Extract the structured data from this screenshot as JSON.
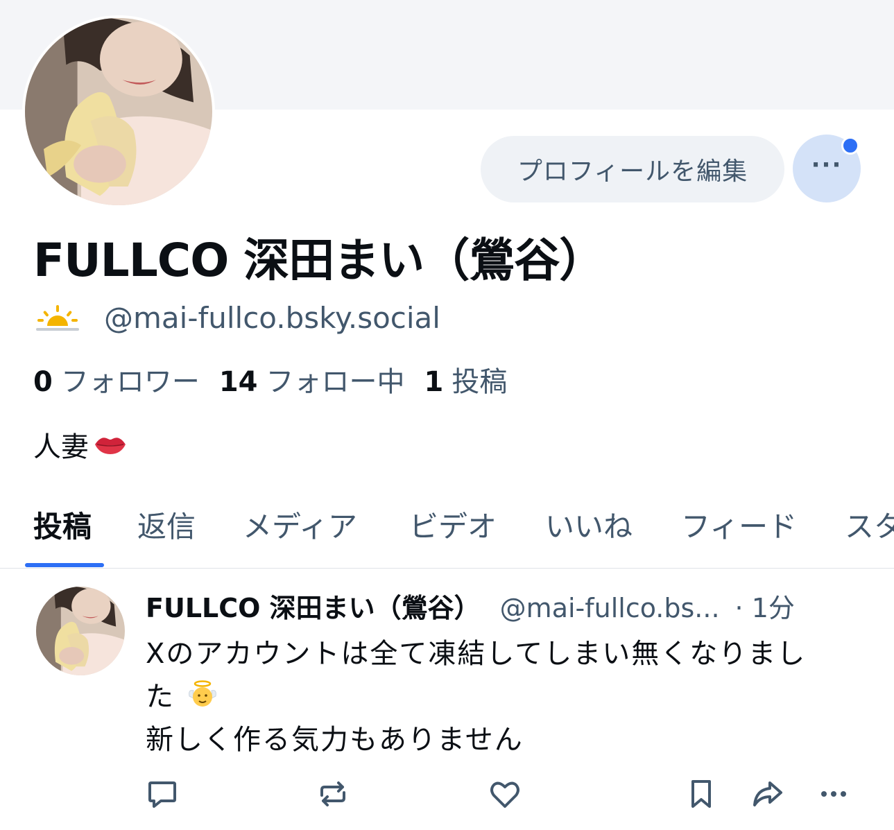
{
  "profile": {
    "edit_button_label": "プロフィールを編集",
    "display_name": "FULLCO 深田まい（鶯谷）",
    "handle": "@mai-fullco.bsky.social",
    "stats": [
      {
        "count": "0",
        "label": "フォロワー"
      },
      {
        "count": "14",
        "label": "フォロー中"
      },
      {
        "count": "1",
        "label": "投稿"
      }
    ],
    "bio": "人妻",
    "bio_emoji": "lips-icon",
    "handle_emoji": "sunrise-icon",
    "has_notification": true
  },
  "tabs": [
    "投稿",
    "返信",
    "メディア",
    "ビデオ",
    "いいね",
    "フィード",
    "スタ"
  ],
  "active_tab": "投稿",
  "post": {
    "author": "FULLCO 深田まい（鶯谷）",
    "handle": "@mai-fullco.bs...",
    "time": "· 1分",
    "line1": "Xのアカウントは全て凍結してしまい無くなりまし",
    "line2": "た",
    "line3": "新しく作る気力もありません",
    "emoji": "baby-angel-icon"
  },
  "actions": [
    "reply-icon",
    "repost-icon",
    "like-icon",
    "bookmark-icon",
    "share-icon",
    "more-icon"
  ],
  "colors": {
    "accent": "#2d6ff5",
    "muted_text": "#42576c",
    "banner": "#f4f5f8",
    "more_button_bg": "#d4e2f8"
  }
}
